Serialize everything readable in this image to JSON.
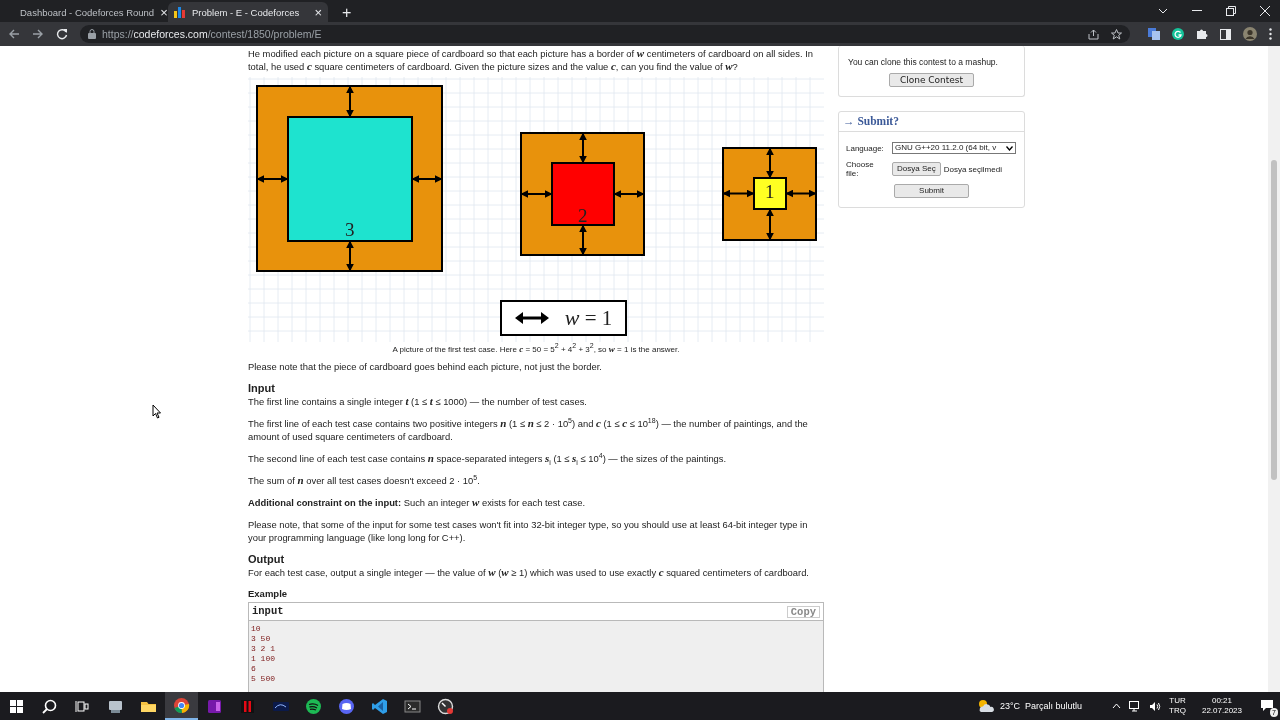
{
  "browser": {
    "tabs": [
      {
        "title": "Dashboard - Codeforces Round",
        "close": "×",
        "selected": false
      },
      {
        "title": "Problem - E - Codeforces",
        "close": "×",
        "selected": true
      }
    ],
    "new_tab": "+",
    "url": {
      "scheme": "https://",
      "host": "codeforces.com",
      "path": "/contest/1850/problem/E"
    }
  },
  "statement": {
    "intro": "He modified each picture on a square piece of cardboard so that each picture has a border of *w* centimeters of cardboard on all sides. In total, he used *c* square centimeters of cardboard. Given the picture sizes and the value *c*, can you find the value of *w*?",
    "figure": {
      "pictures": [
        {
          "label": "3",
          "color": "#1ee3cf"
        },
        {
          "label": "2",
          "color": "#ff0000"
        },
        {
          "label": "1",
          "color": "#ffff22"
        }
      ],
      "legend": "*w* = 1",
      "caption": "A picture of the first test case. Here *c* = 50 = 5$^{2}$ + 4$^{2}$ + 3$^{2}$, so *w* = 1 is the answer."
    },
    "note": "Please note that the piece of cardboard goes behind each picture, not just the border.",
    "sections": [
      {
        "title": "Input",
        "paragraphs": [
          "The first line contains a single integer *t* (1 ≤ *t* ≤ 1000) — the number of test cases.",
          "The first line of each test case contains two positive integers *n* (1 ≤ *n* ≤ 2 · 10$^{5}$) and *c* (1 ≤ *c* ≤ 10$^{18}$) — the number of paintings, and the amount of used square centimeters of cardboard.",
          "The second line of each test case contains *n* space-separated integers *s*$_{i}$ (1 ≤ *s*$_{i}$ ≤ 10$^{4}$) — the sizes of the paintings.",
          "The sum of *n* over all test cases doesn't exceed 2 · 10$^{5}$.",
          "**Additional constraint on the input:** Such an integer *w* exists for each test case.",
          "Please note, that some of the input for some test cases won't fit into 32-bit integer type, so you should use at least 64-bit integer type in your programming language (like long long for C++)."
        ]
      },
      {
        "title": "Output",
        "paragraphs": [
          "For each test case, output a single integer — the value of *w* (*w* ≥ 1) which was used to use exactly *c* squared centimeters of cardboard."
        ]
      }
    ],
    "example": {
      "title": "Example",
      "input_label": "input",
      "copy": "Copy",
      "lines": [
        "10",
        "3 50",
        "3 2 1",
        "1 100",
        "6",
        "5 500"
      ]
    }
  },
  "sidebar": {
    "clone": {
      "text": "You can clone this contest to a mashup.",
      "button": "Clone Contest"
    },
    "submit": {
      "title": "→ Submit?",
      "language_label": "Language:",
      "language": "GNU G++20 11.2.0 (64 bit, v",
      "file_label": "Choose file:",
      "file_button": "Dosya Seç",
      "file_status": "Dosya seçilmedi",
      "button": "Submit"
    }
  },
  "taskbar": {
    "apps": [
      {
        "kind": "start",
        "selected": false
      },
      {
        "kind": "search",
        "selected": false
      },
      {
        "kind": "taskview",
        "selected": false
      },
      {
        "kind": "drive",
        "selected": false
      },
      {
        "kind": "folder",
        "selected": false
      },
      {
        "kind": "browser",
        "selected": true
      },
      {
        "kind": "notebook",
        "selected": false
      },
      {
        "kind": "video",
        "selected": false
      },
      {
        "kind": "streaming",
        "selected": false
      },
      {
        "kind": "music",
        "selected": false
      },
      {
        "kind": "chat",
        "selected": false
      },
      {
        "kind": "editor",
        "selected": false
      },
      {
        "kind": "terminal",
        "selected": false
      },
      {
        "kind": "gauge",
        "selected": false
      }
    ],
    "weather": "23°C  Parçalı bulutlu",
    "lang": [
      "TUR",
      "TRQ"
    ],
    "time": "00:21",
    "date": "22.07.2023",
    "notifications": "7"
  }
}
